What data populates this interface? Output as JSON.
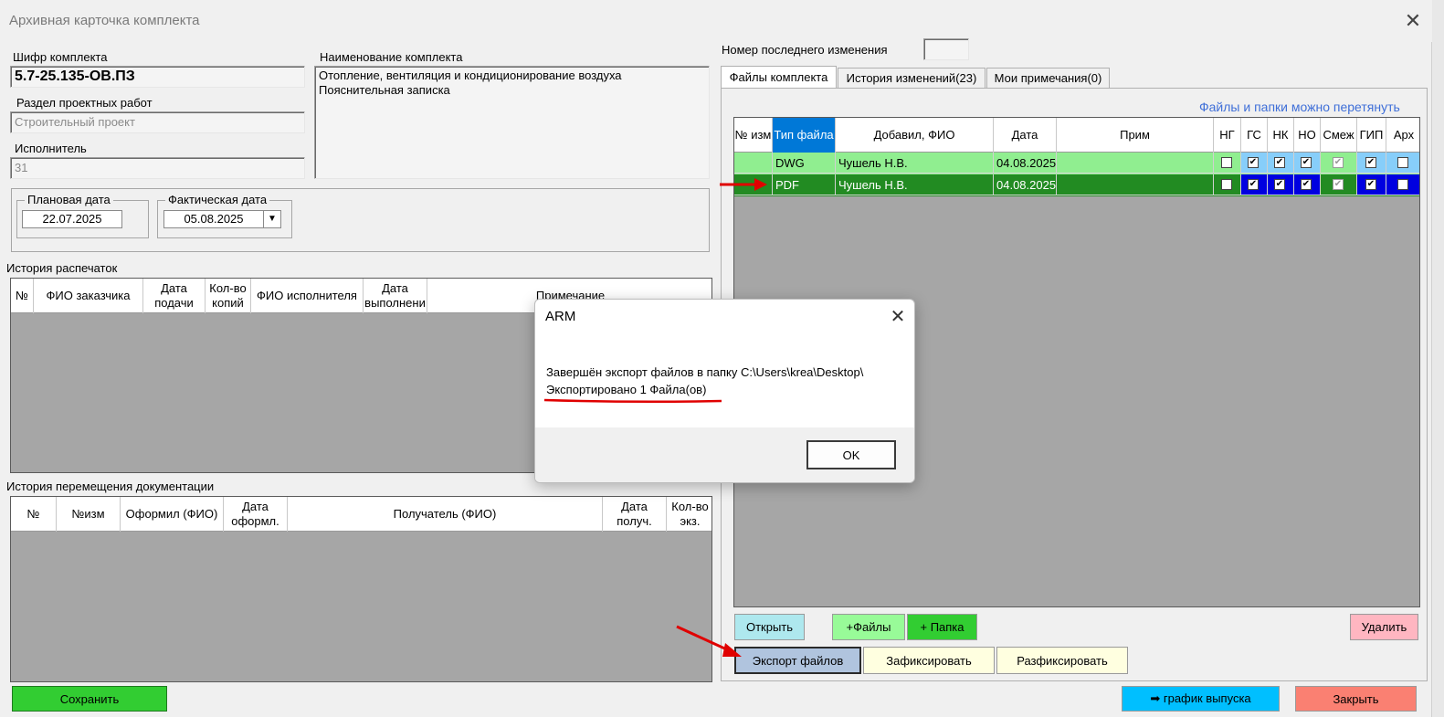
{
  "window": {
    "title": "Архивная карточка комплекта"
  },
  "left": {
    "code_label": "Шифр комплекта",
    "code_value": "5.7-25.135-ОВ.ПЗ",
    "name_label": "Наименование комплекта",
    "name_line1": "Отопление, вентиляция и кондиционирование воздуха",
    "name_line2": "Пояснительная записка",
    "section_label": "Раздел проектных работ",
    "section_value": "Строительный проект",
    "executor_label": "Исполнитель",
    "executor_value": "31",
    "planned_date_label": "Плановая дата",
    "planned_date": "22.07.2025",
    "actual_date_label": "Фактическая дата",
    "actual_date": "05.08.2025",
    "print_history_label": "История распечаток",
    "print_cols": [
      "№",
      "ФИО заказчика",
      "Дата подачи",
      "Кол-во копий",
      "ФИО исполнителя",
      "Дата выполнени",
      "Примечание"
    ],
    "move_history_label": "История перемещения документации",
    "move_cols": [
      "№",
      "№изм",
      "Оформил (ФИО)",
      "Дата оформл.",
      "Получатель (ФИО)",
      "Дата получ.",
      "Кол-во экз."
    ],
    "save_button": "Сохранить"
  },
  "right": {
    "last_change_label": "Номер последнего изменения",
    "last_change_value": "",
    "tabs": [
      "Файлы комплекта",
      "История изменений(23)",
      "Мои примечания(0)"
    ],
    "drag_hint": "Файлы и папки можно перетянуть",
    "cols": [
      "№ изм",
      "Тип файла",
      "Добавил, ФИО",
      "Дата",
      "Прим",
      "НГ",
      "ГС",
      "НК",
      "НО",
      "Смеж",
      "ГИП",
      "Арх"
    ],
    "rows": [
      {
        "izm": "",
        "type": "DWG",
        "author": "Чушель Н.В.",
        "date": "04.08.2025",
        "note": ""
      },
      {
        "izm": "",
        "type": "PDF",
        "author": "Чушель Н.В.",
        "date": "04.08.2025",
        "note": ""
      }
    ],
    "buttons": {
      "open": "Открыть",
      "add_files": "+Файлы",
      "add_folder": "+ Папка",
      "delete": "Удалить",
      "export": "Экспорт файлов",
      "fix": "Зафиксировать",
      "unfix": "Разфиксировать",
      "schedule": "➡ график выпуска",
      "close": "Закрыть"
    }
  },
  "dialog": {
    "title": "ARM",
    "line1": "Завершён экспорт файлов в папку C:\\Users\\krea\\Desktop\\",
    "line2": "Экспортировано 1 Файла(ов)",
    "ok": "OK"
  },
  "colors": {
    "row_dwg": "#90ee90",
    "row_pdf": "#228b22",
    "header_highlight": "#0078d7",
    "annotation": "#e00000"
  }
}
